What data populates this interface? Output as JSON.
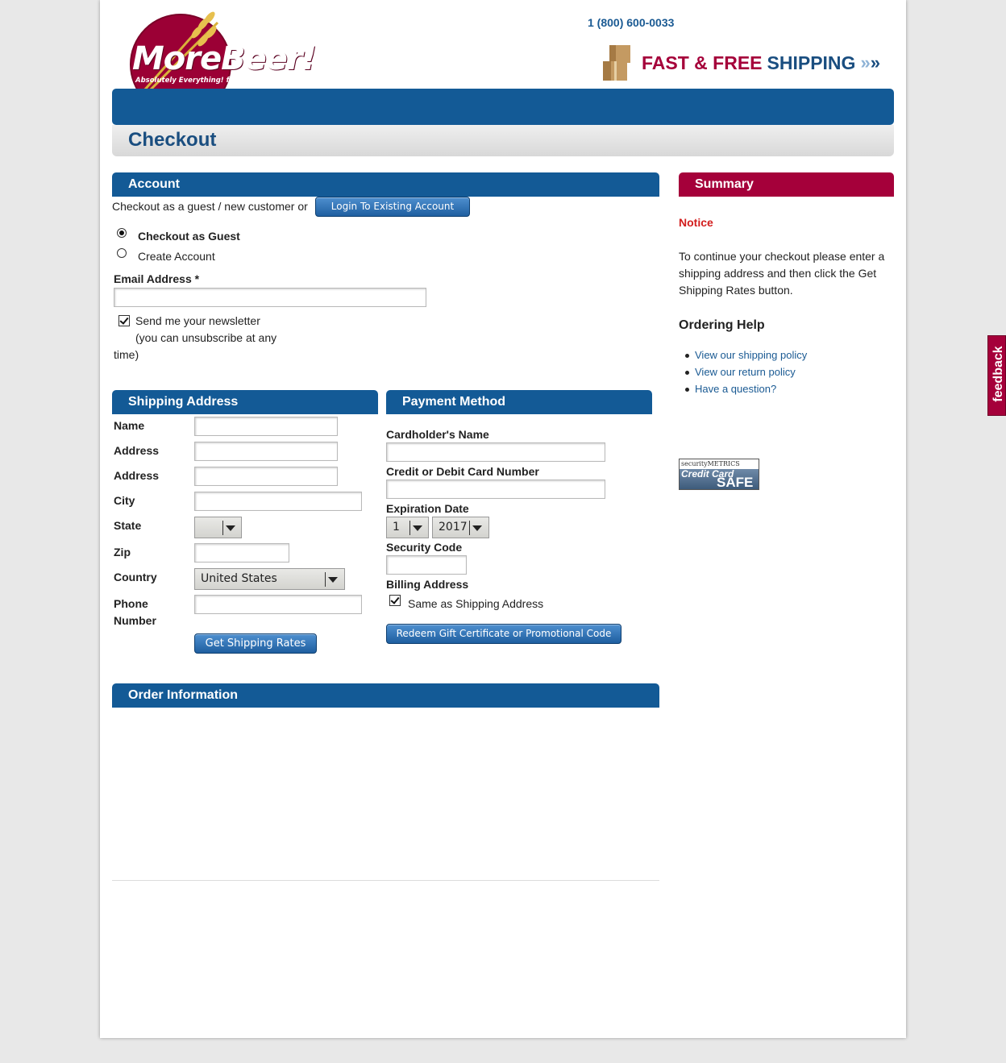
{
  "header": {
    "logo_text": "MoreBeer!",
    "logo_tagline": "Absolutely Everything! for Beer-Making",
    "phone": "1 (800) 600-0033",
    "promo_fast_free": "FAST & FREE",
    "promo_shipping": "SHIPPING",
    "promo_arrows": "»"
  },
  "page_title": "Checkout",
  "account": {
    "heading": "Account",
    "intro": "Checkout as a guest / new customer or",
    "login_button": "Login To Existing Account",
    "option_guest": "Checkout as Guest",
    "option_create": "Create Account",
    "email_label": "Email Address *",
    "newsletter_line1": "Send me your newsletter",
    "newsletter_line2": "(you can unsubscribe at any",
    "newsletter_line3": "time)"
  },
  "shipping": {
    "heading": "Shipping Address",
    "name_label": "Name",
    "address1_label": "Address",
    "address2_label": "Address",
    "city_label": "City",
    "state_label": "State",
    "zip_label": "Zip",
    "country_label": "Country",
    "country_value": "United States",
    "phone_label_1": "Phone",
    "phone_label_2": "Number",
    "button": "Get Shipping Rates"
  },
  "payment": {
    "heading": "Payment Method",
    "cardholder_label": "Cardholder's Name",
    "card_number_label": "Credit or Debit Card Number",
    "expiration_label": "Expiration Date",
    "exp_month": "1",
    "exp_year": "2017",
    "security_label": "Security Code",
    "billing_label": "Billing Address",
    "same_as_shipping": "Same as Shipping Address",
    "redeem_button": "Redeem Gift Certificate or Promotional Code"
  },
  "order": {
    "heading": "Order Information"
  },
  "summary": {
    "heading": "Summary",
    "notice_label": "Notice",
    "notice_line1": "To continue your checkout please enter a",
    "notice_line2": "shipping address and then click the Get",
    "notice_line3": "Shipping Rates button.",
    "help_heading": "Ordering Help",
    "help_links": [
      "View our shipping policy",
      "View our return policy",
      "Have a question?"
    ]
  },
  "badge": {
    "top": "securityMETRICS",
    "mid": "Credit Card",
    "bottom": "SAFE"
  },
  "feedback_tab": "feedback",
  "colors": {
    "brand_blue": "#135a96",
    "brand_red": "#a5003a",
    "link_blue": "#1a5a93"
  }
}
